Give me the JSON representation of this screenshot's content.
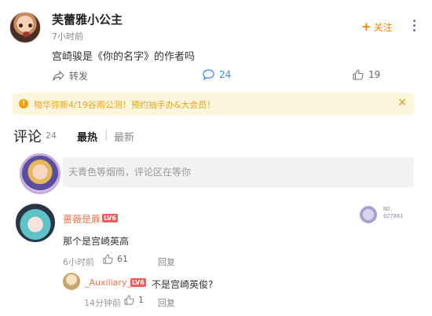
{
  "post": {
    "author": "芙蕾雅小公主",
    "time": "7小时前",
    "follow_label": "关注",
    "text": "宫崎骏是《你的名字》的作者吗",
    "repost_label": "转发",
    "comment_count": "24",
    "like_count": "19"
  },
  "banner": {
    "text": "物华弥新4/19谷雨公测！预约抽手办&大会员！",
    "close": "✕"
  },
  "comments_header": {
    "title": "评论",
    "count": "24",
    "tab_hot": "最热",
    "separator": "|",
    "tab_new": "最新"
  },
  "composer": {
    "placeholder": "天青色等烟雨，评论区在等你"
  },
  "comments": [
    {
      "name": "蔷薇是蔴",
      "level": "LV6",
      "badge_label": "NO.\n027881",
      "text": "那个是宫崎英高",
      "time": "6小时前",
      "likes": "61",
      "reply_label": "回复"
    },
    {
      "name": "_Auxiliary_",
      "level": "LV6",
      "text": "不是宫崎英俊?",
      "time": "14分钟前",
      "likes": "1",
      "reply_label": "回复"
    }
  ],
  "colors": {
    "accent": "#ff8200",
    "link": "#3a8fd8",
    "username": "#eb7350",
    "banner_bg": "#fdf6dd",
    "banner_text": "#e8a31d"
  },
  "icons": [
    "repost-icon",
    "comment-icon",
    "like-icon",
    "info-icon",
    "more-icon"
  ]
}
